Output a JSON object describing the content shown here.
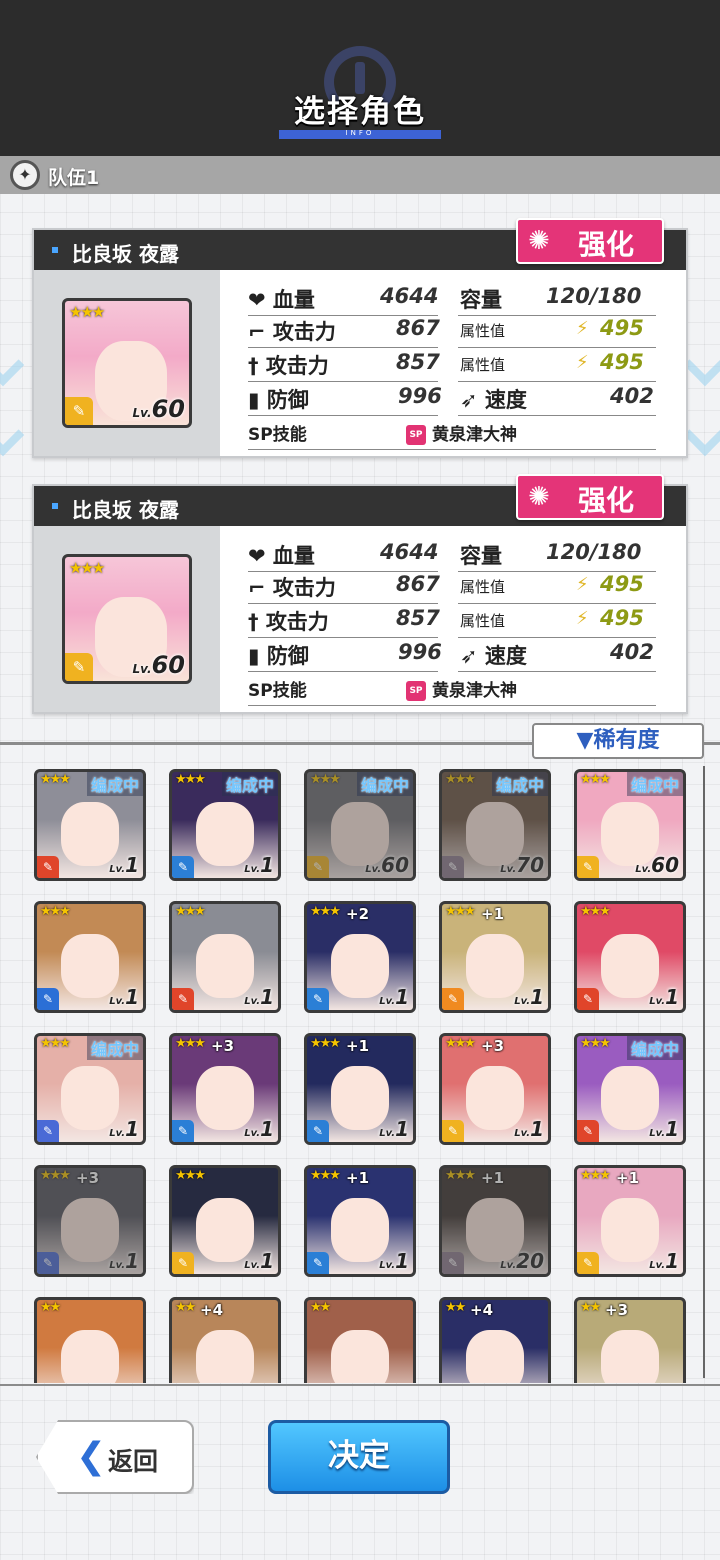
{
  "header": {
    "title": "选择角色",
    "subtitle": "INFO"
  },
  "team": {
    "label": "队伍1"
  },
  "cards": [
    {
      "name": "比良坂 夜露",
      "enhance": "强化",
      "stars": "★★★",
      "level_prefix": "Lv.",
      "level": "60",
      "stats": {
        "hp_label": "血量",
        "hp": "4644",
        "capacity_label": "容量",
        "capacity": "120/180",
        "atk1_label": "攻击力",
        "atk1": "867",
        "attr1_label": "属性值",
        "attr1": "495",
        "atk2_label": "攻击力",
        "atk2": "857",
        "attr2_label": "属性值",
        "attr2": "495",
        "def_label": "防御",
        "def": "996",
        "speed_label": "速度",
        "speed": "402",
        "sp_label": "SP技能",
        "sp_icon": "SP",
        "sp_skill": "黄泉津大神"
      }
    },
    {
      "name": "比良坂 夜露",
      "enhance": "强化",
      "stars": "★★★",
      "level_prefix": "Lv.",
      "level": "60",
      "stats": {
        "hp_label": "血量",
        "hp": "4644",
        "capacity_label": "容量",
        "capacity": "120/180",
        "atk1_label": "攻击力",
        "atk1": "867",
        "attr1_label": "属性值",
        "attr1": "495",
        "atk2_label": "攻击力",
        "atk2": "857",
        "attr2_label": "属性值",
        "attr2": "495",
        "def_label": "防御",
        "def": "996",
        "speed_label": "速度",
        "speed": "402",
        "sp_label": "SP技能",
        "sp_icon": "SP",
        "sp_skill": "黄泉津大神"
      }
    }
  ],
  "sort": {
    "label": "▼稀有度"
  },
  "roster": [
    {
      "stars": "★★★",
      "plus": "",
      "level": "1",
      "formed": "编成中",
      "hair": "#8e8e98",
      "type_color": "#e0452a",
      "dim": false
    },
    {
      "stars": "★★★",
      "plus": "",
      "level": "1",
      "formed": "编成中",
      "hair": "#3a2b5c",
      "type_color": "#2b7fd6",
      "dim": false
    },
    {
      "stars": "★★★",
      "plus": "",
      "level": "60",
      "formed": "编成中",
      "hair": "#6a6a70",
      "type_color": "#f0b220",
      "dim": true
    },
    {
      "stars": "★★★",
      "plus": "",
      "level": "70",
      "formed": "编成中",
      "hair": "#6b5240",
      "type_color": "#8c7a8c",
      "dim": true
    },
    {
      "stars": "★★★",
      "plus": "",
      "level": "60",
      "formed": "编成中",
      "hair": "#f0a8c0",
      "type_color": "#f0b220",
      "dim": false
    },
    {
      "stars": "★★★",
      "plus": "",
      "level": "1",
      "formed": "",
      "hair": "#c28a55",
      "type_color": "#2b6fd6",
      "dim": false
    },
    {
      "stars": "★★★",
      "plus": "",
      "level": "1",
      "formed": "",
      "hair": "#8a8c94",
      "type_color": "#e0452a",
      "dim": false
    },
    {
      "stars": "★★★",
      "plus": "+2",
      "level": "1",
      "formed": "",
      "hair": "#2a2e66",
      "type_color": "#2b7fd6",
      "dim": false
    },
    {
      "stars": "★★★",
      "plus": "+1",
      "level": "1",
      "formed": "",
      "hair": "#c9b37a",
      "type_color": "#f08a20",
      "dim": false
    },
    {
      "stars": "★★★",
      "plus": "",
      "level": "1",
      "formed": "",
      "hair": "#e04a66",
      "type_color": "#e0452a",
      "dim": false
    },
    {
      "stars": "★★★",
      "plus": "",
      "level": "1",
      "formed": "编成中",
      "hair": "#e5b0a8",
      "type_color": "#4a6ad6",
      "dim": false
    },
    {
      "stars": "★★★",
      "plus": "+3",
      "level": "1",
      "formed": "",
      "hair": "#6a3a78",
      "type_color": "#2b7fd6",
      "dim": false
    },
    {
      "stars": "★★★",
      "plus": "+1",
      "level": "1",
      "formed": "",
      "hair": "#232a5e",
      "type_color": "#2b7fd6",
      "dim": false
    },
    {
      "stars": "★★★",
      "plus": "+3",
      "level": "1",
      "formed": "",
      "hair": "#e07070",
      "type_color": "#f0b220",
      "dim": false
    },
    {
      "stars": "★★★",
      "plus": "",
      "level": "1",
      "formed": "编成中",
      "hair": "#9a5cc0",
      "type_color": "#e0452a",
      "dim": false
    },
    {
      "stars": "★★★",
      "plus": "+3",
      "level": "1",
      "formed": "",
      "hair": "#50505a",
      "type_color": "#4a6ad6",
      "dim": true
    },
    {
      "stars": "★★★",
      "plus": "",
      "level": "1",
      "formed": "",
      "hair": "#262a40",
      "type_color": "#f0b220",
      "dim": false
    },
    {
      "stars": "★★★",
      "plus": "+1",
      "level": "1",
      "formed": "",
      "hair": "#2a3270",
      "type_color": "#2b7fd6",
      "dim": false
    },
    {
      "stars": "★★★",
      "plus": "+1",
      "level": "20",
      "formed": "",
      "hair": "#3a302c",
      "type_color": "#8c7a8c",
      "dim": true
    },
    {
      "stars": "★★★",
      "plus": "+1",
      "level": "1",
      "formed": "",
      "hair": "#e8a8c0",
      "type_color": "#f0b220",
      "dim": false
    },
    {
      "stars": "★★",
      "plus": "",
      "level": "",
      "formed": "",
      "hair": "#d07a40",
      "type_color": "",
      "dim": false
    },
    {
      "stars": "★★",
      "plus": "+4",
      "level": "",
      "formed": "",
      "hair": "#b8865a",
      "type_color": "",
      "dim": false
    },
    {
      "stars": "★★",
      "plus": "",
      "level": "",
      "formed": "",
      "hair": "#a0604a",
      "type_color": "",
      "dim": false
    },
    {
      "stars": "★★",
      "plus": "+4",
      "level": "",
      "formed": "",
      "hair": "#2a2e66",
      "type_color": "",
      "dim": false
    },
    {
      "stars": "★★",
      "plus": "+3",
      "level": "",
      "formed": "",
      "hair": "#b8aa78",
      "type_color": "",
      "dim": false
    }
  ],
  "buttons": {
    "back": "返回",
    "confirm": "决定"
  }
}
